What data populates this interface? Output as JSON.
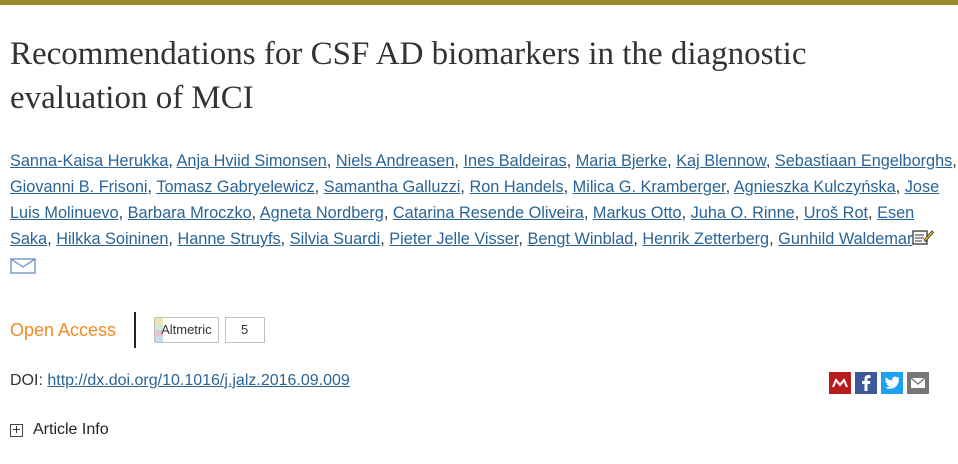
{
  "title": "Recommendations for CSF AD biomarkers in the diagnostic evaluation of MCI",
  "authors": [
    "Sanna-Kaisa Herukka",
    "Anja Hviid Simonsen",
    "Niels Andreasen",
    "Ines Baldeiras",
    "Maria Bjerke",
    "Kaj Blennow",
    "Sebastiaan Engelborghs",
    "Giovanni B. Frisoni",
    "Tomasz Gabryelewicz",
    "Samantha Galluzzi",
    "Ron Handels",
    "Milica G. Kramberger",
    "Agnieszka Kulczyńska",
    "Jose Luis Molinuevo",
    "Barbara Mroczko",
    "Agneta Nordberg",
    "Catarina Resende Oliveira",
    "Markus Otto",
    "Juha O. Rinne",
    "Uroš Rot",
    "Esen Saka",
    "Hilkka Soininen",
    "Hanne Struyfs",
    "Silvia Suardi",
    "Pieter Jelle Visser",
    "Bengt Winblad",
    "Henrik Zetterberg",
    "Gunhild Waldemar"
  ],
  "author_separator": ", ",
  "access": {
    "label": "Open Access"
  },
  "altmetric": {
    "label": "Altmetric",
    "count": "5"
  },
  "doi": {
    "prefix": "DOI:",
    "link": "http://dx.doi.org/10.1016/j.jalz.2016.09.009"
  },
  "share_icons": [
    {
      "name": "mendeley-icon",
      "color": "#b71c1c"
    },
    {
      "name": "facebook-icon",
      "color": "#3b5998"
    },
    {
      "name": "twitter-icon",
      "color": "#1da1f2"
    },
    {
      "name": "email-icon",
      "color": "#777777"
    }
  ],
  "article_info": {
    "label": "Article Info",
    "toggle": "+"
  }
}
